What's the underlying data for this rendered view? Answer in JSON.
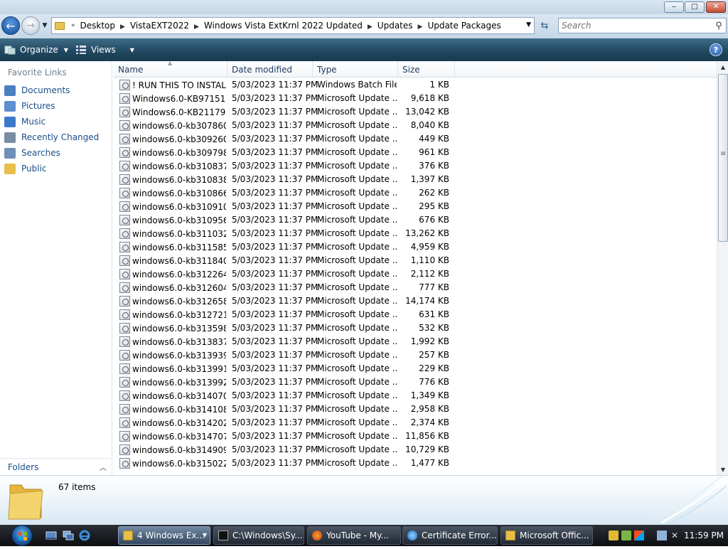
{
  "titlebar": {
    "minimize": "‒",
    "maximize": "□",
    "close": "✕"
  },
  "address": {
    "prefix": "«",
    "crumbs": [
      "Desktop",
      "VistaEXT2022",
      "Windows Vista ExtKrnl 2022 Updated",
      "Updates",
      "Update Packages"
    ],
    "search_placeholder": "Search"
  },
  "commands": {
    "organize": "Organize",
    "views": "Views",
    "help": "?"
  },
  "nav": {
    "title": "Favorite Links",
    "items": [
      {
        "label": "Documents",
        "icon": "documents-icon",
        "color": "#4a7fc0"
      },
      {
        "label": "Pictures",
        "icon": "pictures-icon",
        "color": "#5b8fd0"
      },
      {
        "label": "Music",
        "icon": "music-icon",
        "color": "#3e78c9"
      },
      {
        "label": "Recently Changed",
        "icon": "recently-changed-icon",
        "color": "#7a8ca3"
      },
      {
        "label": "Searches",
        "icon": "searches-icon",
        "color": "#6f8fb5"
      },
      {
        "label": "Public",
        "icon": "public-folder-icon",
        "color": "#e6bf4a"
      }
    ],
    "folders_label": "Folders"
  },
  "columns": {
    "name": "Name",
    "date": "Date modified",
    "type": "Type",
    "size": "Size"
  },
  "files": [
    {
      "name": "! RUN THIS TO INSTAL...",
      "date": "5/03/2023 11:37 PM",
      "type": "Windows Batch File",
      "size": "1 KB",
      "kind": "batch"
    },
    {
      "name": "Windows6.0-KB971512...",
      "date": "5/03/2023 11:37 PM",
      "type": "Microsoft Update ...",
      "size": "9,618 KB",
      "kind": "msu"
    },
    {
      "name": "Windows6.0-KB211791...",
      "date": "5/03/2023 11:37 PM",
      "type": "Microsoft Update ...",
      "size": "13,042 KB",
      "kind": "msu"
    },
    {
      "name": "windows6.0-kb307860...",
      "date": "5/03/2023 11:37 PM",
      "type": "Microsoft Update ...",
      "size": "8,040 KB",
      "kind": "msu"
    },
    {
      "name": "windows6.0-kb309260...",
      "date": "5/03/2023 11:37 PM",
      "type": "Microsoft Update ...",
      "size": "449 KB",
      "kind": "msu"
    },
    {
      "name": "windows6.0-kb309798...",
      "date": "5/03/2023 11:37 PM",
      "type": "Microsoft Update ...",
      "size": "961 KB",
      "kind": "msu"
    },
    {
      "name": "windows6.0-kb310837...",
      "date": "5/03/2023 11:37 PM",
      "type": "Microsoft Update ...",
      "size": "376 KB",
      "kind": "msu"
    },
    {
      "name": "windows6.0-kb310838...",
      "date": "5/03/2023 11:37 PM",
      "type": "Microsoft Update ...",
      "size": "1,397 KB",
      "kind": "msu"
    },
    {
      "name": "windows6.0-kb310866...",
      "date": "5/03/2023 11:37 PM",
      "type": "Microsoft Update ...",
      "size": "262 KB",
      "kind": "msu"
    },
    {
      "name": "windows6.0-kb310910...",
      "date": "5/03/2023 11:37 PM",
      "type": "Microsoft Update ...",
      "size": "295 KB",
      "kind": "msu"
    },
    {
      "name": "windows6.0-kb310956...",
      "date": "5/03/2023 11:37 PM",
      "type": "Microsoft Update ...",
      "size": "676 KB",
      "kind": "msu"
    },
    {
      "name": "windows6.0-kb311032...",
      "date": "5/03/2023 11:37 PM",
      "type": "Microsoft Update ...",
      "size": "13,262 KB",
      "kind": "msu"
    },
    {
      "name": "windows6.0-kb311585...",
      "date": "5/03/2023 11:37 PM",
      "type": "Microsoft Update ...",
      "size": "4,959 KB",
      "kind": "msu"
    },
    {
      "name": "windows6.0-kb311840...",
      "date": "5/03/2023 11:37 PM",
      "type": "Microsoft Update ...",
      "size": "1,110 KB",
      "kind": "msu"
    },
    {
      "name": "windows6.0-kb312264...",
      "date": "5/03/2023 11:37 PM",
      "type": "Microsoft Update ...",
      "size": "2,112 KB",
      "kind": "msu"
    },
    {
      "name": "windows6.0-kb312604...",
      "date": "5/03/2023 11:37 PM",
      "type": "Microsoft Update ...",
      "size": "777 KB",
      "kind": "msu"
    },
    {
      "name": "windows6.0-kb312658...",
      "date": "5/03/2023 11:37 PM",
      "type": "Microsoft Update ...",
      "size": "14,174 KB",
      "kind": "msu"
    },
    {
      "name": "windows6.0-kb312721...",
      "date": "5/03/2023 11:37 PM",
      "type": "Microsoft Update ...",
      "size": "631 KB",
      "kind": "msu"
    },
    {
      "name": "windows6.0-kb313598...",
      "date": "5/03/2023 11:37 PM",
      "type": "Microsoft Update ...",
      "size": "532 KB",
      "kind": "msu"
    },
    {
      "name": "windows6.0-kb313837...",
      "date": "5/03/2023 11:37 PM",
      "type": "Microsoft Update ...",
      "size": "1,992 KB",
      "kind": "msu"
    },
    {
      "name": "windows6.0-kb313939...",
      "date": "5/03/2023 11:37 PM",
      "type": "Microsoft Update ...",
      "size": "257 KB",
      "kind": "msu"
    },
    {
      "name": "windows6.0-kb313991...",
      "date": "5/03/2023 11:37 PM",
      "type": "Microsoft Update ...",
      "size": "229 KB",
      "kind": "msu"
    },
    {
      "name": "windows6.0-kb313992...",
      "date": "5/03/2023 11:37 PM",
      "type": "Microsoft Update ...",
      "size": "776 KB",
      "kind": "msu"
    },
    {
      "name": "windows6.0-kb314070...",
      "date": "5/03/2023 11:37 PM",
      "type": "Microsoft Update ...",
      "size": "1,349 KB",
      "kind": "msu"
    },
    {
      "name": "windows6.0-kb314108...",
      "date": "5/03/2023 11:37 PM",
      "type": "Microsoft Update ...",
      "size": "2,958 KB",
      "kind": "msu"
    },
    {
      "name": "windows6.0-kb314202...",
      "date": "5/03/2023 11:37 PM",
      "type": "Microsoft Update ...",
      "size": "2,374 KB",
      "kind": "msu"
    },
    {
      "name": "windows6.0-kb314707...",
      "date": "5/03/2023 11:37 PM",
      "type": "Microsoft Update ...",
      "size": "11,856 KB",
      "kind": "msu"
    },
    {
      "name": "windows6.0-kb314909...",
      "date": "5/03/2023 11:37 PM",
      "type": "Microsoft Update ...",
      "size": "10,729 KB",
      "kind": "msu"
    },
    {
      "name": "windows6.0-kb315022...",
      "date": "5/03/2023 11:37 PM",
      "type": "Microsoft Update ...",
      "size": "1,477 KB",
      "kind": "msu"
    }
  ],
  "status": {
    "items_count": "67 items"
  },
  "taskbar": {
    "buttons": [
      {
        "label": "4 Windows Ex...",
        "icon": "explorer-folder-icon",
        "active": true,
        "has_drop": true
      },
      {
        "label": "C:\\Windows\\Sy...",
        "icon": "command-prompt-icon",
        "active": false,
        "has_drop": false
      },
      {
        "label": "YouTube - My...",
        "icon": "firefox-icon",
        "active": false,
        "has_drop": false
      },
      {
        "label": "Certificate Error...",
        "icon": "internet-explorer-icon",
        "active": false,
        "has_drop": false
      },
      {
        "label": "Microsoft Offic...",
        "icon": "office-folder-icon",
        "active": false,
        "has_drop": false
      }
    ],
    "clock": "11:59 PM"
  }
}
